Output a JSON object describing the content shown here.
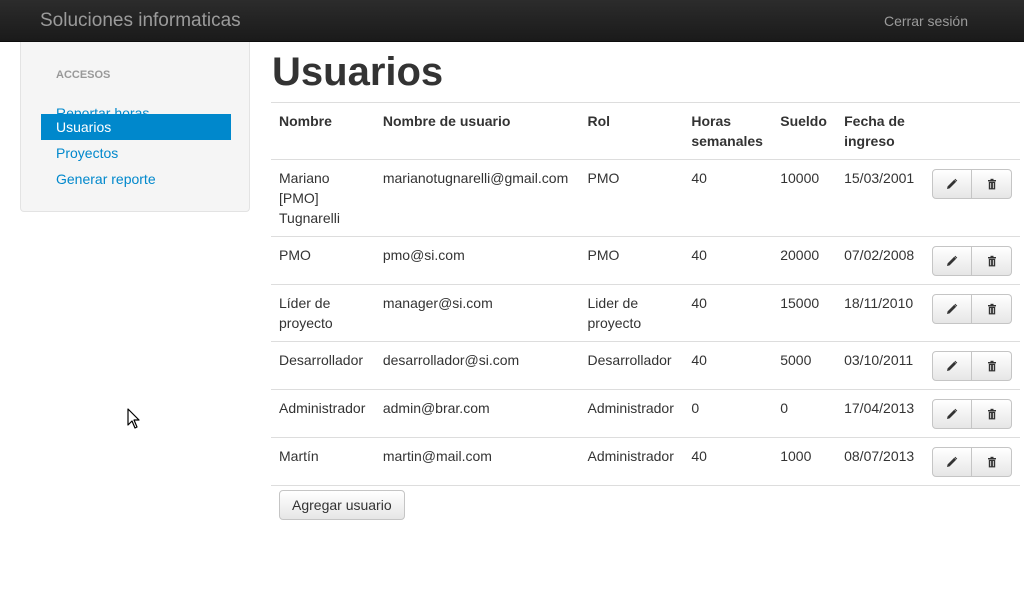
{
  "navbar": {
    "brand": "Soluciones informaticas",
    "logout": "Cerrar sesión"
  },
  "sidebar": {
    "header": "ACCESOS",
    "items": [
      {
        "label": "Reportar horas",
        "active": false
      },
      {
        "label": "Usuarios",
        "active": true
      },
      {
        "label": "Proyectos",
        "active": false
      },
      {
        "label": "Generar reporte",
        "active": false
      }
    ]
  },
  "main": {
    "title": "Usuarios",
    "table": {
      "headers": {
        "name": "Nombre",
        "username": "Nombre de usuario",
        "role": "Rol",
        "hours": "Horas semanales",
        "salary": "Sueldo",
        "date": "Fecha de ingreso"
      },
      "rows": [
        {
          "name": "Mariano [PMO] Tugnarelli",
          "username": "marianotugnarelli@gmail.com",
          "role": "PMO",
          "hours": "40",
          "salary": "10000",
          "date": "15/03/2001"
        },
        {
          "name": "PMO",
          "username": "pmo@si.com",
          "role": "PMO",
          "hours": "40",
          "salary": "20000",
          "date": "07/02/2008"
        },
        {
          "name": "Líder de proyecto",
          "username": "manager@si.com",
          "role": "Lider de proyecto",
          "hours": "40",
          "salary": "15000",
          "date": "18/11/2010"
        },
        {
          "name": "Desarrollador",
          "username": "desarrollador@si.com",
          "role": "Desarrollador",
          "hours": "40",
          "salary": "5000",
          "date": "03/10/2011"
        },
        {
          "name": "Administrador",
          "username": "admin@brar.com",
          "role": "Administrador",
          "hours": "0",
          "salary": "0",
          "date": "17/04/2013"
        },
        {
          "name": "Martín",
          "username": "martin@mail.com",
          "role": "Administrador",
          "hours": "40",
          "salary": "1000",
          "date": "08/07/2013"
        }
      ],
      "row_actions": {
        "edit_icon": "pencil-icon",
        "delete_icon": "trash-icon"
      }
    },
    "add_button": "Agregar usuario"
  },
  "colors": {
    "navbar": "#1f1f1f",
    "link": "#0088cc",
    "active": "#0088cc",
    "sidebar_bg": "#f5f5f5"
  }
}
